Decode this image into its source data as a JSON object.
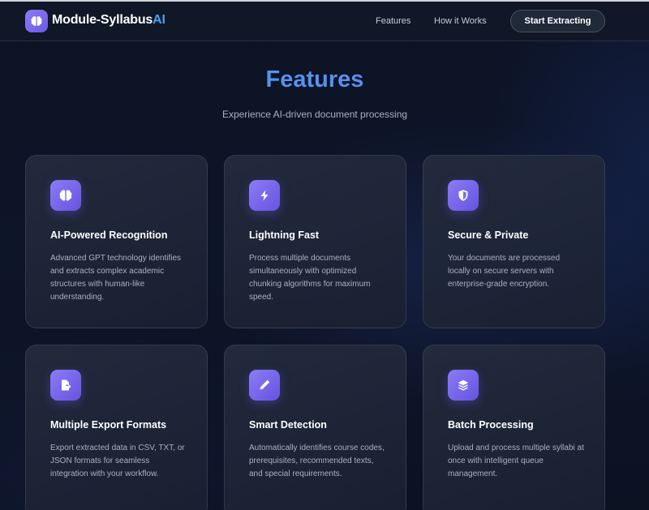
{
  "nav": {
    "brand_main": "Module-Syllabus",
    "brand_accent": "AI",
    "links": [
      "Features",
      "How it Works"
    ],
    "cta": "Start Extracting"
  },
  "hero": {
    "title": "Features",
    "subtitle": "Experience AI-driven document processing"
  },
  "features": [
    {
      "icon": "brain-icon",
      "title": "AI-Powered Recognition",
      "description": "Advanced GPT technology identifies and extracts complex academic structures with human-like understanding."
    },
    {
      "icon": "bolt-icon",
      "title": "Lightning Fast",
      "description": "Process multiple documents simultaneously with optimized chunking algorithms for maximum speed."
    },
    {
      "icon": "shield-icon",
      "title": "Secure & Private",
      "description": "Your documents are processed locally on secure servers with enterprise-grade encryption."
    },
    {
      "icon": "file-export-icon",
      "title": "Multiple Export Formats",
      "description": "Export extracted data in CSV, TXT, or JSON formats for seamless integration with your workflow."
    },
    {
      "icon": "pen-icon",
      "title": "Smart Detection",
      "description": "Automatically identifies course codes, prerequisites, recommended texts, and special requirements."
    },
    {
      "icon": "layers-icon",
      "title": "Batch Processing",
      "description": "Upload and process multiple syllabi at once with intelligent queue management."
    }
  ],
  "colors": {
    "accent_purple": "#7c6cf0",
    "accent_blue": "#4aa3f0",
    "background": "#0b1120"
  }
}
